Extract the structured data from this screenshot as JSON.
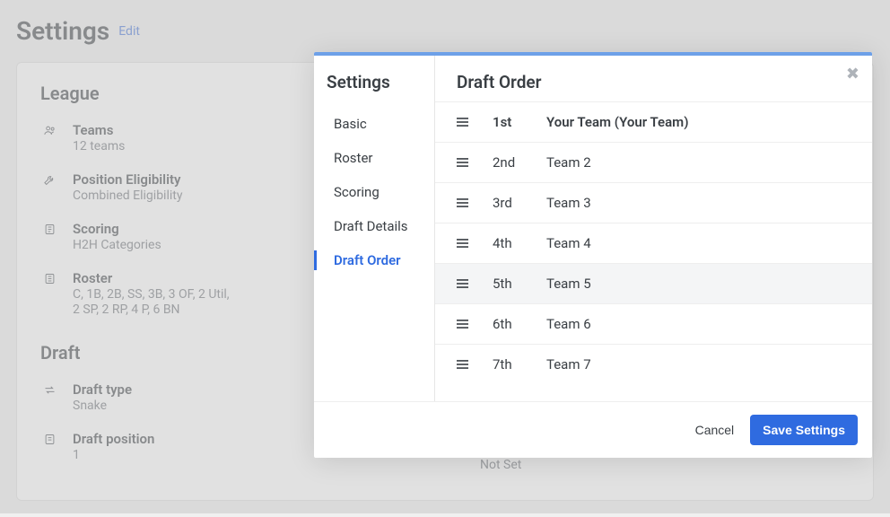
{
  "header": {
    "title": "Settings",
    "edit_link": "Edit"
  },
  "league": {
    "section_title": "League",
    "teams": {
      "label": "Teams",
      "value": "12 teams"
    },
    "position_eligibility": {
      "label": "Position Eligibility",
      "value": "Combined Eligibility"
    },
    "scoring": {
      "label": "Scoring",
      "value": "H2H Categories"
    },
    "roster": {
      "label": "Roster",
      "line1": "C, 1B, 2B, SS, 3B, 3 OF, 2 Util,",
      "line2": "2 SP, 2 RP, 4 P, 6 BN"
    }
  },
  "draft": {
    "section_title": "Draft",
    "draft_type": {
      "label": "Draft type",
      "value": "Snake"
    },
    "draft_position": {
      "label": "Draft position",
      "value": "1"
    },
    "not_set_label": "Not Set"
  },
  "modal": {
    "sidebar_title": "Settings",
    "nav": {
      "basic": "Basic",
      "roster": "Roster",
      "scoring": "Scoring",
      "draft_details": "Draft Details",
      "draft_order": "Draft Order"
    },
    "content_title": "Draft Order",
    "rows": [
      {
        "pos": "1st",
        "team": "Your Team (Your Team)"
      },
      {
        "pos": "2nd",
        "team": "Team 2"
      },
      {
        "pos": "3rd",
        "team": "Team 3"
      },
      {
        "pos": "4th",
        "team": "Team 4"
      },
      {
        "pos": "5th",
        "team": "Team 5"
      },
      {
        "pos": "6th",
        "team": "Team 6"
      },
      {
        "pos": "7th",
        "team": "Team 7"
      }
    ],
    "footer": {
      "cancel": "Cancel",
      "save": "Save Settings"
    }
  }
}
